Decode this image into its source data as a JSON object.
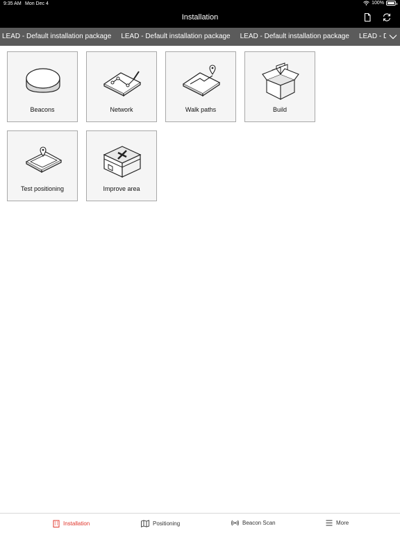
{
  "status_bar": {
    "time": "9:35 AM",
    "date": "Mon Dec 4",
    "battery": "100%",
    "battery_level": 1.0
  },
  "nav": {
    "title": "Installation",
    "icons": [
      "document-icon",
      "refresh-icon"
    ]
  },
  "packages": [
    "LEAD - Default installation package",
    "LEAD - Default installation package",
    "LEAD - Default installation package",
    "LEAD - Default installation package"
  ],
  "tiles": [
    {
      "label": "Beacons",
      "icon": "beacon-icon"
    },
    {
      "label": "Network",
      "icon": "network-icon"
    },
    {
      "label": "Walk paths",
      "icon": "walk-paths-icon"
    },
    {
      "label": "Build",
      "icon": "build-box-icon"
    },
    {
      "label": "Test positioning",
      "icon": "test-positioning-icon"
    },
    {
      "label": "Improve area",
      "icon": "improve-area-icon"
    }
  ],
  "bottom_tabs": [
    {
      "label": "Installation",
      "icon": "building-icon",
      "active": true
    },
    {
      "label": "Positioning",
      "icon": "map-icon",
      "active": false
    },
    {
      "label": "Beacon Scan",
      "icon": "beacon-scan-icon",
      "active": false
    },
    {
      "label": "More",
      "icon": "menu-icon",
      "active": false
    }
  ],
  "colors": {
    "accent": "#e0352b",
    "tab_strip": "#5b5b5b",
    "header": "#000000"
  }
}
